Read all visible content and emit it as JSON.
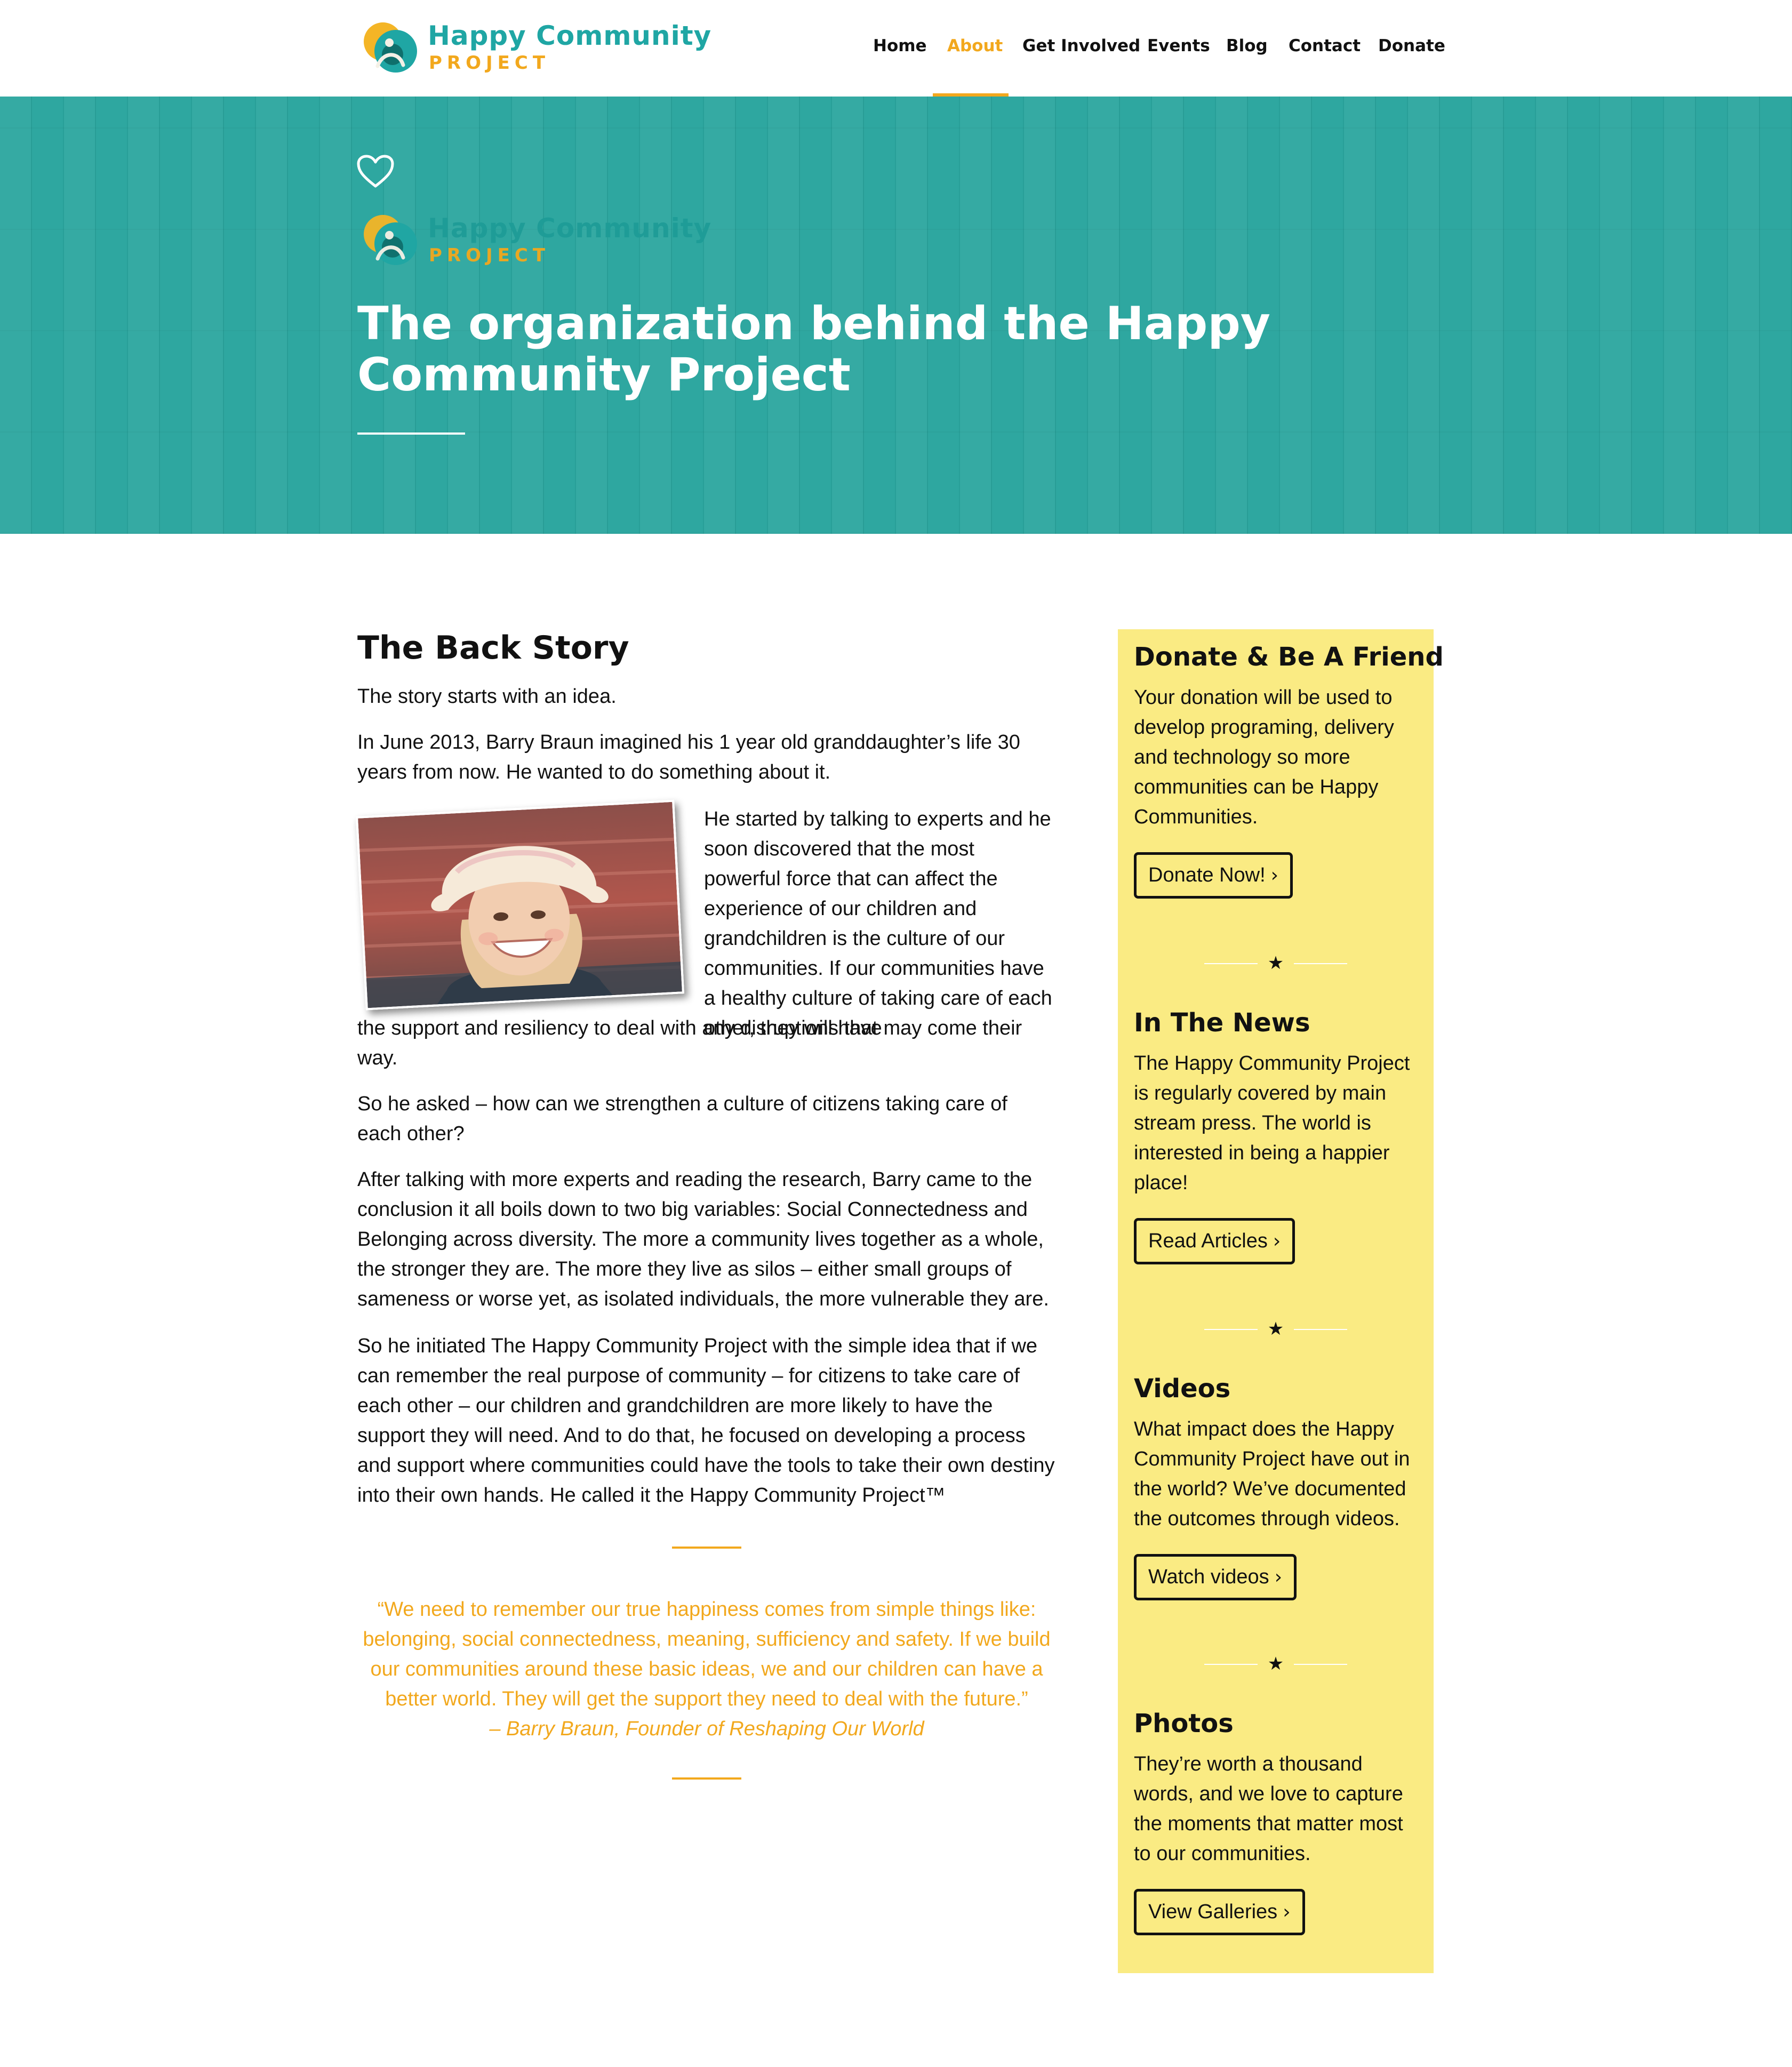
{
  "header": {
    "logo": {
      "name": "Happy Community",
      "sub": "PROJECT"
    },
    "nav": [
      {
        "label": "Home"
      },
      {
        "label": "About"
      },
      {
        "label": "Get Involved"
      },
      {
        "label": "Events"
      },
      {
        "label": "Blog"
      },
      {
        "label": "Contact"
      },
      {
        "label": "Donate"
      }
    ],
    "active_nav": "About"
  },
  "hero": {
    "logo": {
      "name": "Happy Community",
      "sub": "PROJECT"
    },
    "title": "The organization behind the Happy Community Project",
    "icon": "heart-icon"
  },
  "main": {
    "heading": "The Back Story",
    "p1": "The story starts with an idea.",
    "p2": "In June 2013, Barry Braun imagined his 1 year old granddaughter’s life 30 years from now. He wanted to do something about it.",
    "p3_wrap": "He started by talking to experts and he soon discovered that the most powerful force that can affect the experience of our children and grandchildren is the culture of our communities. If our communities have a healthy culture of taking care of each other, they will have",
    "p3_rest": "the support and resiliency to deal with any disruptions that may come their way.",
    "p4": "So he asked – how can we strengthen a culture of citizens taking care of each other?",
    "p5": "After talking with more experts and reading the research, Barry came to the conclusion it all boils down to two big variables: Social Connectedness and Belonging across diversity. The more a community lives together as a whole, the stronger they are. The more they live as silos – either small groups of sameness or worse yet, as isolated individuals, the more vulnerable they are.",
    "p6": "So he initiated The Happy Community Project with the simple idea that if we can remember the real purpose of community – for citizens to take care of each other – our children and grandchildren are more likely to have the support they will need. And to do that, he focused on developing a process and support where communities could have the tools to take their own destiny into their own hands. He called it the Happy Community Project™",
    "quote": "“We need to remember our true happiness comes from simple things like: belonging, social connectedness, meaning, sufficiency and safety. If we build our communities around these basic ideas, we and our children can have a better world. They will get the support they need to deal with the future.”",
    "quote_cite": "– Barry Braun, Founder of Reshaping Our World"
  },
  "sidebar": {
    "cards": [
      {
        "title": "Donate & Be A Friend",
        "text": "Your donation will be used to develop programing, delivery and technology so more communities can be Happy Communities.",
        "button": "Donate Now!"
      },
      {
        "title": "In The News",
        "text": "The Happy Community Project is regularly covered by main stream press. The world is interested in being a happier place!",
        "button": "Read Articles"
      },
      {
        "title": "Videos",
        "text": "What impact does the Happy Community Project have out in the world? We’ve documented the outcomes through videos.",
        "button": "Watch videos"
      },
      {
        "title": "Photos",
        "text": "They’re worth a thousand words, and we love to capture the moments that matter most to our communities.",
        "button": "View Galleries"
      }
    ],
    "divider_glyph": "★",
    "button_chevron": "›"
  },
  "colors": {
    "teal": "#2aa59e",
    "orange": "#f2a81d",
    "sidebar_yellow": "#faeb83"
  }
}
